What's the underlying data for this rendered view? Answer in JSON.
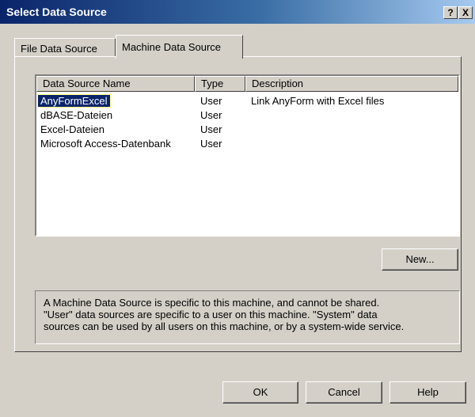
{
  "window": {
    "title": "Select Data Source",
    "help_glyph": "?",
    "close_glyph": "X"
  },
  "tabs": [
    {
      "label": "File Data Source",
      "active": false
    },
    {
      "label": "Machine Data Source",
      "active": true
    }
  ],
  "list": {
    "columns": [
      "Data Source Name",
      "Type",
      "Description"
    ],
    "rows": [
      {
        "name": "AnyFormExcel",
        "type": "User",
        "description": "Link AnyForm with Excel files",
        "selected": true
      },
      {
        "name": "dBASE-Dateien",
        "type": "User",
        "description": ""
      },
      {
        "name": "Excel-Dateien",
        "type": "User",
        "description": ""
      },
      {
        "name": "Microsoft Access-Datenbank",
        "type": "User",
        "description": ""
      }
    ]
  },
  "new_button": {
    "label": "New..."
  },
  "info_text_lines": [
    "A Machine Data Source is specific to this machine, and cannot be shared.",
    "\"User\" data sources are specific to a user on this machine.  \"System\" data",
    "sources can be used by all users on this machine, or by a system-wide service."
  ],
  "buttons": {
    "ok": "OK",
    "cancel": "Cancel",
    "help": "Help"
  },
  "colors": {
    "title_start": "#0a246a",
    "title_end": "#a6caf0",
    "face": "#d4d0c8",
    "selection": "#0a246a"
  }
}
